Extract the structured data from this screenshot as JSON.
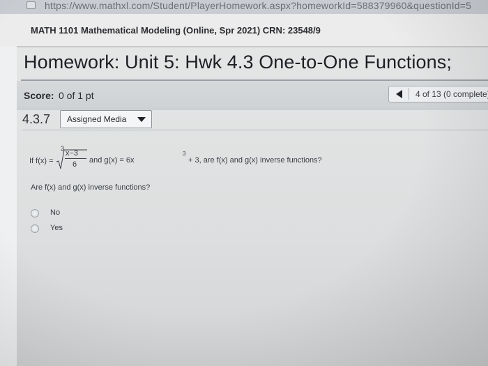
{
  "browser": {
    "url": "https://www.mathxl.com/Student/PlayerHomework.aspx?homeworkId=588379960&questionId=5"
  },
  "course": {
    "title": "MATH 1101 Mathematical Modeling (Online, Spr 2021) CRN: 23548/9"
  },
  "homework": {
    "title": "Homework: Unit 5: Hwk 4.3 One-to-One Functions;",
    "score_label": "Score:",
    "score_value": "0 of 1 pt",
    "nav_text": "4 of 13 (0 complete)"
  },
  "question": {
    "number": "4.3.7",
    "media_button": "Assigned Media",
    "if_text": "If f(x) =",
    "root_index": "3",
    "frac_numerator": "x−3",
    "frac_denominator": "6",
    "rest_text": "and g(x) = 6x",
    "exponent": "3",
    "rest_text_2": "+ 3, are f(x) and g(x) inverse functions?",
    "prompt": "Are f(x) and g(x) inverse functions?",
    "choices": [
      "No",
      "Yes"
    ]
  },
  "icons": {
    "prev": "left-triangle-arrow-icon",
    "dropdown": "caret-down-icon",
    "lock": "lock-icon"
  }
}
